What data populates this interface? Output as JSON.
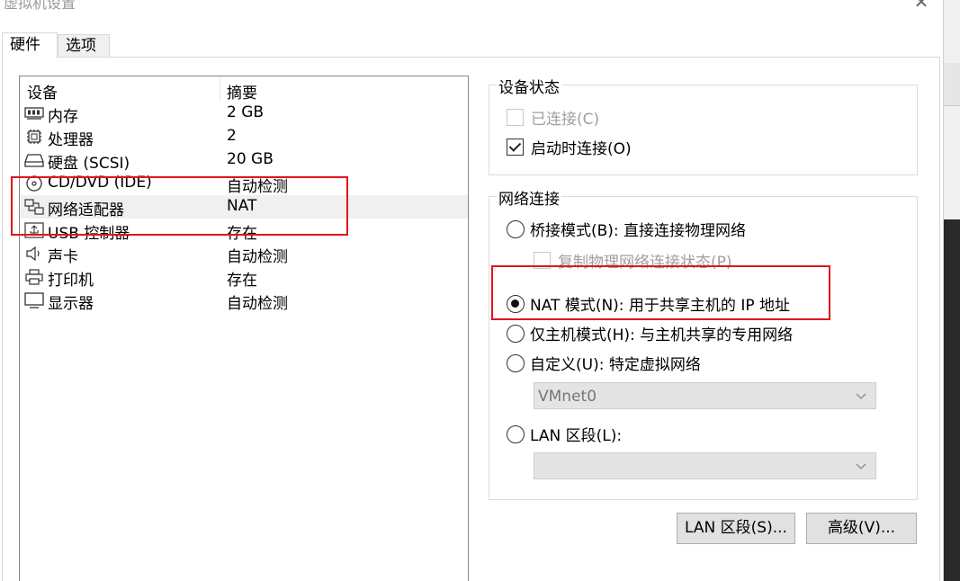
{
  "window": {
    "title": "虚拟机设置"
  },
  "tabs": [
    {
      "label": "硬件",
      "active": true
    },
    {
      "label": "选项",
      "active": false
    }
  ],
  "device_list": {
    "headers": {
      "device": "设备",
      "summary": "摘要"
    },
    "rows": [
      {
        "name": "内存",
        "summary": "2 GB",
        "icon": "memory-icon"
      },
      {
        "name": "处理器",
        "summary": "2",
        "icon": "cpu-icon"
      },
      {
        "name": "硬盘 (SCSI)",
        "summary": "20 GB",
        "icon": "hard-disk-icon"
      },
      {
        "name": "CD/DVD (IDE)",
        "summary": "自动检测",
        "icon": "cd-dvd-icon"
      },
      {
        "name": "网络适配器",
        "summary": "NAT",
        "icon": "network-adapter-icon",
        "selected": true
      },
      {
        "name": "USB 控制器",
        "summary": "存在",
        "icon": "usb-icon"
      },
      {
        "name": "声卡",
        "summary": "自动检测",
        "icon": "speaker-icon"
      },
      {
        "name": "打印机",
        "summary": "存在",
        "icon": "printer-icon"
      },
      {
        "name": "显示器",
        "summary": "自动检测",
        "icon": "monitor-icon"
      }
    ]
  },
  "device_status": {
    "title": "设备状态",
    "connected": {
      "label": "已连接(C)",
      "checked": false,
      "enabled": false
    },
    "connect_at_power_on": {
      "label": "启动时连接(O)",
      "checked": true,
      "enabled": true
    }
  },
  "network_connection": {
    "title": "网络连接",
    "bridged": {
      "label": "桥接模式(B): 直接连接物理网络",
      "selected": false
    },
    "replicate": {
      "label": "复制物理网络连接状态(P)",
      "checked": false,
      "enabled": false
    },
    "nat": {
      "label": "NAT 模式(N): 用于共享主机的 IP 地址",
      "selected": true
    },
    "host_only": {
      "label": "仅主机模式(H): 与主机共享的专用网络",
      "selected": false
    },
    "custom": {
      "label": "自定义(U): 特定虚拟网络",
      "selected": false
    },
    "custom_select": {
      "value": "VMnet0",
      "enabled": false
    },
    "lan_segment": {
      "label": "LAN 区段(L):",
      "selected": false
    },
    "lan_select": {
      "value": "",
      "enabled": false
    }
  },
  "buttons": {
    "lan_segments": "LAN 区段(S)...",
    "advanced": "高级(V)..."
  },
  "colors": {
    "highlight_annotation": "#e0141e",
    "selected_row": "#f0f0f0",
    "disabled_text": "#a0a0a0"
  }
}
